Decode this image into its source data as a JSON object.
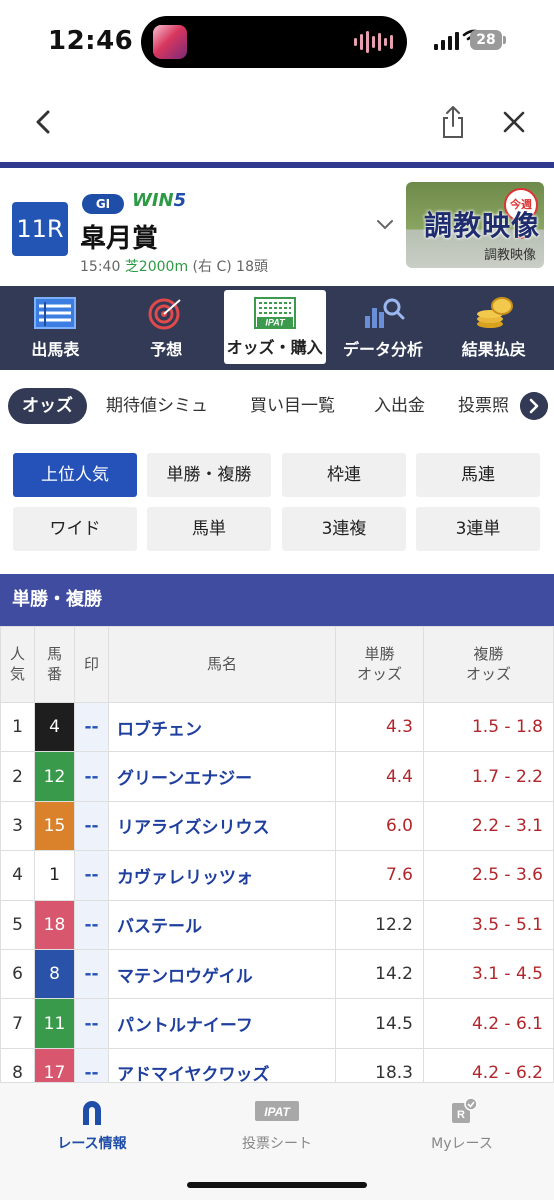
{
  "status_bar": {
    "time": "12:46",
    "battery": "28"
  },
  "race": {
    "number": "11R",
    "grade": "GI",
    "win5_prefix": "WIN",
    "win5_suffix": "5",
    "name": "皐月賞",
    "time": "15:40",
    "surface": "芝2000m",
    "course": "(右 C)",
    "runners": "18頭"
  },
  "video": {
    "title": "調教映像",
    "badge": "今週の",
    "caption": "調教映像"
  },
  "category_nav": [
    {
      "label": "出馬表",
      "icon": "entry-table-icon"
    },
    {
      "label": "予想",
      "icon": "target-icon"
    },
    {
      "label": "オッズ・購入",
      "icon": "ipat-icon",
      "icon_text": "IPAT"
    },
    {
      "label": "データ分析",
      "icon": "chart-search-icon"
    },
    {
      "label": "結果払戻",
      "icon": "coins-icon"
    }
  ],
  "sub_tabs": [
    {
      "label": "オッズ"
    },
    {
      "label": "期待値シミュ"
    },
    {
      "label": "買い目一覧"
    },
    {
      "label": "入出金"
    },
    {
      "label": "投票照"
    }
  ],
  "odds_buttons": [
    {
      "label": "上位人気"
    },
    {
      "label": "単勝・複勝"
    },
    {
      "label": "枠連"
    },
    {
      "label": "馬連"
    },
    {
      "label": "ワイド"
    },
    {
      "label": "馬単"
    },
    {
      "label": "3連複"
    },
    {
      "label": "3連単"
    }
  ],
  "section": {
    "title": "単勝・複勝"
  },
  "table": {
    "headers": {
      "rank_1": "人",
      "rank_2": "気",
      "num_1": "馬",
      "num_2": "番",
      "mark": "印",
      "name": "馬名",
      "win_1": "単勝",
      "win_2": "オッズ",
      "place_1": "複勝",
      "place_2": "オッズ"
    },
    "rows": [
      {
        "rank": "1",
        "num": "4",
        "color": "#1e1e1e",
        "mark": "--",
        "name": "ロブチェン",
        "win": "4.3",
        "place": "1.5 - 1.8",
        "win_hot": true
      },
      {
        "rank": "2",
        "num": "12",
        "color": "#3a9a4c",
        "mark": "--",
        "name": "グリーンエナジー",
        "win": "4.4",
        "place": "1.7 - 2.2",
        "win_hot": true
      },
      {
        "rank": "3",
        "num": "15",
        "color": "#d9812b",
        "mark": "--",
        "name": "リアライズシリウス",
        "win": "6.0",
        "place": "2.2 - 3.1",
        "win_hot": true
      },
      {
        "rank": "4",
        "num": "1",
        "color": "#ffffff",
        "mark": "--",
        "name": "カヴァレリッツォ",
        "win": "7.6",
        "place": "2.5 - 3.6",
        "win_hot": true
      },
      {
        "rank": "5",
        "num": "18",
        "color": "#d9576e",
        "mark": "--",
        "name": "バステール",
        "win": "12.2",
        "place": "3.5 - 5.1",
        "win_hot": false
      },
      {
        "rank": "6",
        "num": "8",
        "color": "#2a52a8",
        "mark": "--",
        "name": "マテンロウゲイル",
        "win": "14.2",
        "place": "3.1 - 4.5",
        "win_hot": false
      },
      {
        "rank": "7",
        "num": "11",
        "color": "#3a9a4c",
        "mark": "--",
        "name": "パントルナイーフ",
        "win": "14.5",
        "place": "4.2 - 6.1",
        "win_hot": false
      },
      {
        "rank": "8",
        "num": "17",
        "color": "#d9576e",
        "mark": "--",
        "name": "アドマイヤクワッズ",
        "win": "18.3",
        "place": "4.2 - 6.2",
        "win_hot": false
      }
    ]
  },
  "tab_bar": [
    {
      "label": "レース情報",
      "icon": "horseshoe-icon"
    },
    {
      "label": "投票シート",
      "icon": "ipat-sheet-icon",
      "icon_text": "IPAT"
    },
    {
      "label": "Myレース",
      "icon": "my-race-icon",
      "icon_text": "R"
    }
  ],
  "colors": {
    "primary": "#2452b8",
    "nav_dark": "#323a56",
    "section": "#3f4ca0",
    "odds_red": "#b0262b"
  }
}
